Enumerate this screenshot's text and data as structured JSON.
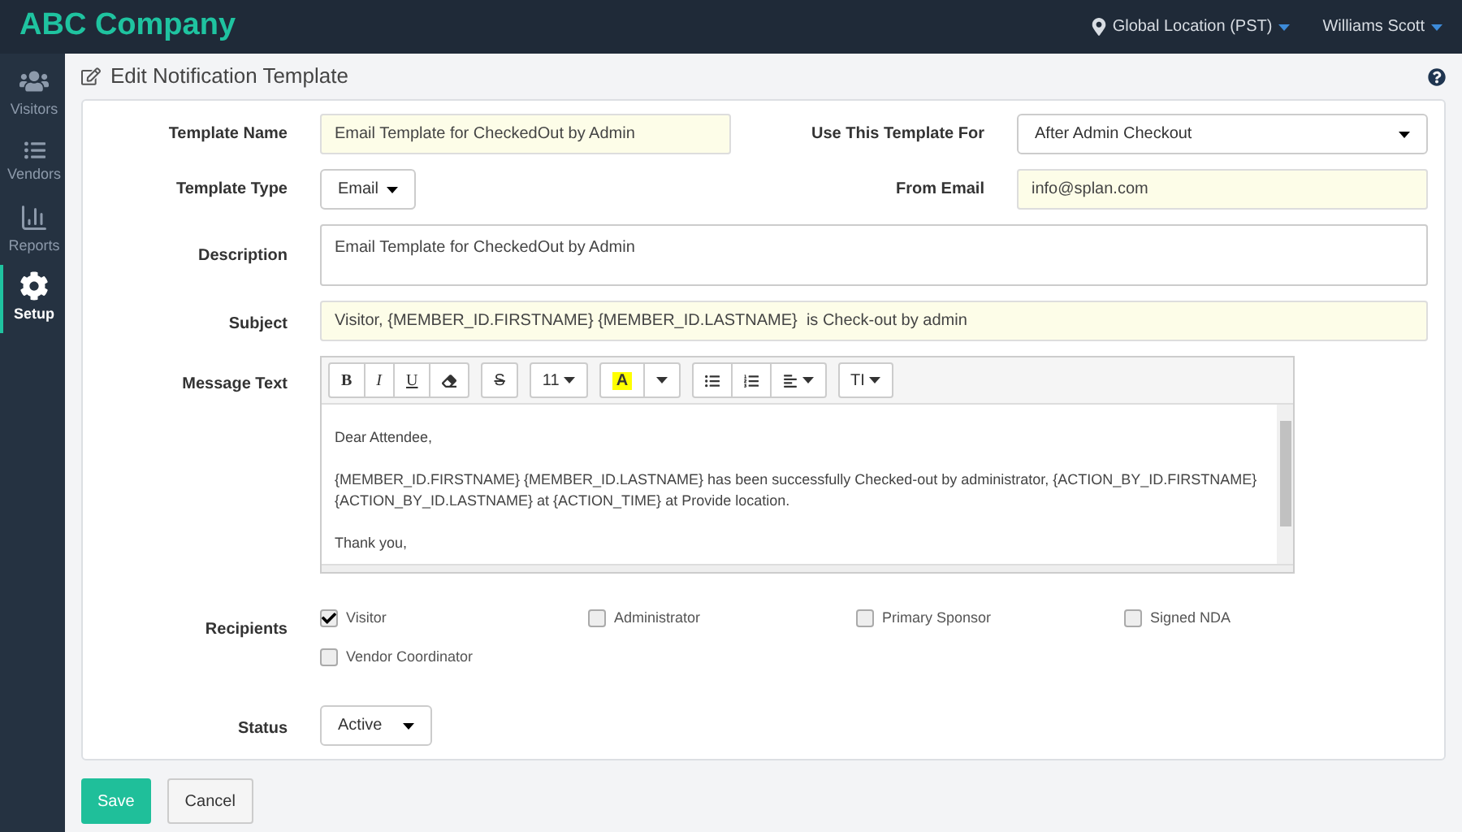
{
  "header": {
    "brand": "ABC Company",
    "location": "Global Location (PST)",
    "user": "Williams Scott"
  },
  "sidebar": {
    "items": [
      {
        "label": "Visitors",
        "kind": "users",
        "selected": false
      },
      {
        "label": "Vendors",
        "kind": "list",
        "selected": false
      },
      {
        "label": "Reports",
        "kind": "chart",
        "selected": false
      },
      {
        "label": "Setup",
        "kind": "gear",
        "selected": true
      }
    ]
  },
  "page": {
    "title": "Edit Notification Template"
  },
  "form": {
    "template_name": {
      "label": "Template Name",
      "value": "Email Template for CheckedOut by Admin"
    },
    "use_for": {
      "label": "Use This Template For",
      "value": "After Admin Checkout"
    },
    "template_type": {
      "label": "Template Type",
      "value": "Email"
    },
    "from_email": {
      "label": "From Email",
      "value": "info@splan.com"
    },
    "description": {
      "label": "Description",
      "value": "Email Template for CheckedOut by Admin"
    },
    "subject": {
      "label": "Subject",
      "value": "Visitor, {MEMBER_ID.FIRSTNAME} {MEMBER_ID.LASTNAME}  is Check-out by admin"
    },
    "message": {
      "label": "Message Text",
      "toolbar": [
        [
          {
            "kind": "bold",
            "text": "B"
          },
          {
            "kind": "italic",
            "text": "I"
          },
          {
            "kind": "underline",
            "text": "U"
          },
          {
            "kind": "eraser"
          }
        ],
        [
          {
            "kind": "strike",
            "text": "S"
          }
        ],
        [
          {
            "kind": "menu",
            "text": "11"
          }
        ],
        [
          {
            "kind": "highlight",
            "text": "A"
          },
          {
            "kind": "caret"
          }
        ],
        [
          {
            "kind": "bullets"
          },
          {
            "kind": "numbers"
          },
          {
            "kind": "align"
          }
        ],
        [
          {
            "kind": "menu",
            "text": "TI"
          }
        ]
      ],
      "paragraphs": [
        "Dear Attendee,",
        "{MEMBER_ID.FIRSTNAME} {MEMBER_ID.LASTNAME} has been successfully Checked-out by administrator, {ACTION_BY_ID.FIRSTNAME} {ACTION_BY_ID.LASTNAME} at {ACTION_TIME} at Provide location.",
        "Thank you,"
      ]
    },
    "recipients": {
      "label": "Recipients",
      "options": [
        {
          "label": "Visitor",
          "checked": true
        },
        {
          "label": "Administrator",
          "checked": false
        },
        {
          "label": "Primary Sponsor",
          "checked": false
        },
        {
          "label": "Signed NDA",
          "checked": false
        },
        {
          "label": "Vendor Coordinator",
          "checked": false
        }
      ]
    },
    "status": {
      "label": "Status",
      "value": "Active"
    }
  },
  "buttons": {
    "save": "Save",
    "cancel": "Cancel"
  }
}
